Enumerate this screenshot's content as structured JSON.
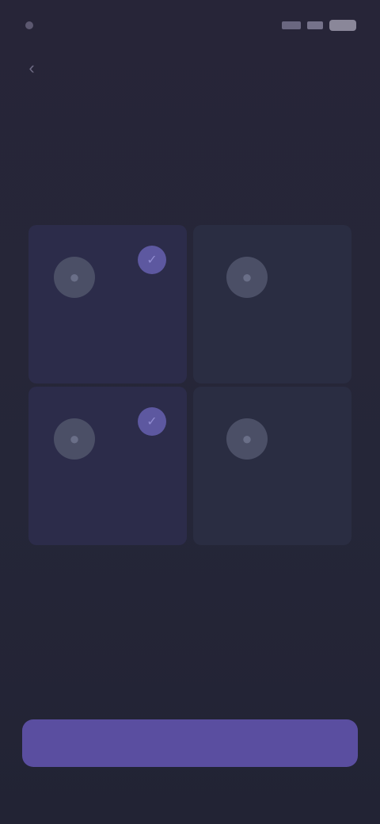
{
  "status_bar": {
    "time": ""
  },
  "header": {
    "back_icon": "arrow-left-icon"
  },
  "main": {
    "title": "",
    "subtitle": "",
    "options": [
      {
        "label": "",
        "icon": "circle-icon",
        "selected": true
      },
      {
        "label": "",
        "icon": "circle-icon",
        "selected": false
      },
      {
        "label": "",
        "icon": "circle-icon",
        "selected": true
      },
      {
        "label": "",
        "icon": "circle-icon",
        "selected": false
      }
    ]
  },
  "footer": {
    "continue_label": ""
  },
  "colors": {
    "background": "#252638",
    "card": "#2a2d42",
    "accent": "#5a4ea0",
    "check": "#5d58a0"
  }
}
